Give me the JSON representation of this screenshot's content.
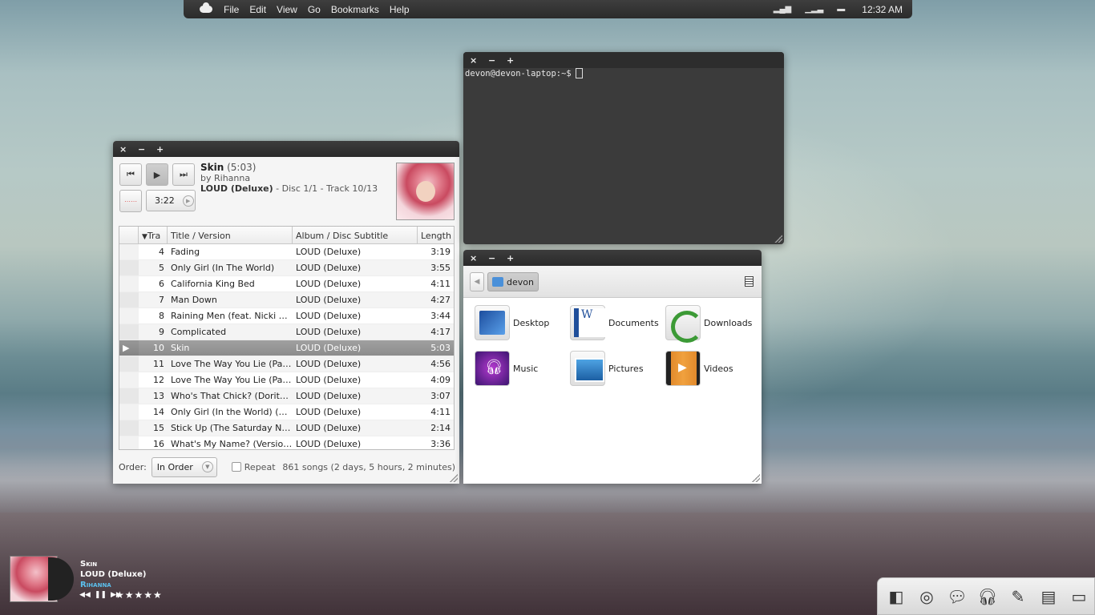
{
  "top_panel": {
    "menus": [
      "File",
      "Edit",
      "View",
      "Go",
      "Bookmarks",
      "Help"
    ],
    "clock": "12:32 AM"
  },
  "player": {
    "title_buttons": [
      "×",
      "−",
      "+"
    ],
    "song_title": "Skin",
    "song_duration": "(5:03)",
    "artist_line": "by Rihanna",
    "album_name": "LOUD (Deluxe)",
    "album_detail": " - Disc 1/1 - Track 10/13",
    "position": "3:22",
    "columns": [
      "Tra",
      "Title / Version",
      "Album / Disc Subtitle",
      "Length"
    ],
    "tracks": [
      {
        "num": "4",
        "title": "Fading",
        "album": "LOUD (Deluxe)",
        "length": "3:19"
      },
      {
        "num": "5",
        "title": "Only Girl (In The World)",
        "album": "LOUD (Deluxe)",
        "length": "3:55"
      },
      {
        "num": "6",
        "title": "California King Bed",
        "album": "LOUD (Deluxe)",
        "length": "4:11"
      },
      {
        "num": "7",
        "title": "Man Down",
        "album": "LOUD (Deluxe)",
        "length": "4:27"
      },
      {
        "num": "8",
        "title": "Raining Men (feat. Nicki Mi...",
        "album": "LOUD (Deluxe)",
        "length": "3:44"
      },
      {
        "num": "9",
        "title": "Complicated",
        "album": "LOUD (Deluxe)",
        "length": "4:17"
      },
      {
        "num": "10",
        "title": "Skin",
        "album": "LOUD (Deluxe)",
        "length": "5:03",
        "playing": true
      },
      {
        "num": "11",
        "title": "Love The Way You Lie (Part I...",
        "album": "LOUD (Deluxe)",
        "length": "4:56"
      },
      {
        "num": "12",
        "title": "Love The Way You Lie (Part I...",
        "album": "LOUD (Deluxe)",
        "length": "4:09"
      },
      {
        "num": "13",
        "title": "Who's That Chick? (Doritos ...",
        "album": "LOUD (Deluxe)",
        "length": "3:07"
      },
      {
        "num": "14",
        "title": "Only Girl (In the World) (Re...",
        "album": "LOUD (Deluxe)",
        "length": "4:11"
      },
      {
        "num": "15",
        "title": "Stick Up (The Saturday Nigh...",
        "album": "LOUD (Deluxe)",
        "length": "2:14"
      },
      {
        "num": "16",
        "title": "What's My Name? (Version ...",
        "album": "LOUD (Deluxe)",
        "length": "3:36"
      }
    ],
    "order_label": "Order:",
    "order_value": "In Order",
    "repeat_label": "Repeat",
    "song_count": "861 songs (2 days, 5 hours, 2 minutes)"
  },
  "terminal": {
    "prompt": "devon@devon-laptop:~$"
  },
  "files": {
    "breadcrumb": "devon",
    "folders": [
      "Desktop",
      "Documents",
      "Downloads",
      "Music",
      "Pictures",
      "Videos"
    ]
  },
  "now_playing": {
    "title": "Skin",
    "album": "LOUD (Deluxe)",
    "artist": "Rihanna",
    "rating": "★★★★★"
  }
}
